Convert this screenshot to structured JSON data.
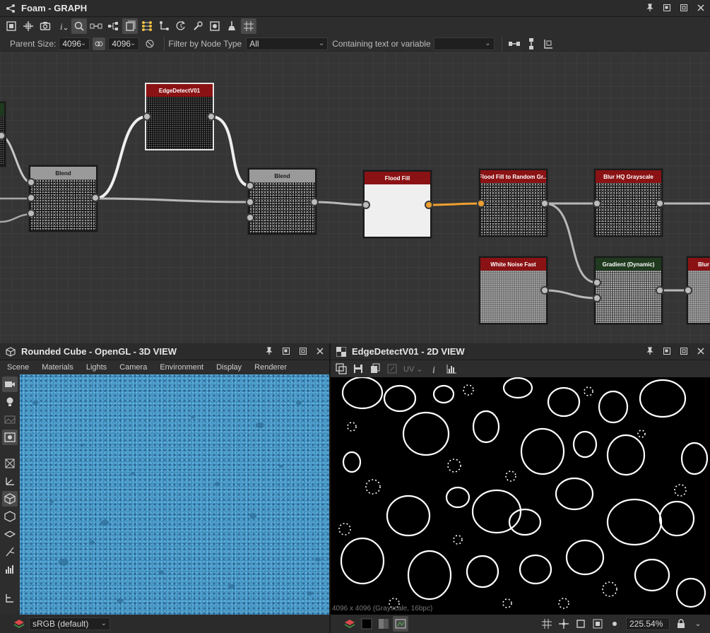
{
  "graph_panel": {
    "title": "Foam - GRAPH",
    "toolbar_icons": [
      "frame-all-icon",
      "fit-icon",
      "camera-icon",
      "info-icon",
      "zoom-icon",
      "link-icon",
      "hierarchy-icon",
      "layer-icon",
      "align-icon",
      "pin-node-icon",
      "loop-icon",
      "tools-icon",
      "display-icon",
      "clean-icon",
      "grid-icon"
    ],
    "filter": {
      "parent_size_label": "Parent Size:",
      "parent_size_w": "4096",
      "parent_size_h": "4096",
      "filter_label": "Filter by Node Type",
      "filter_value": "All",
      "containing_label": "Containing text or variable",
      "containing_value": ""
    },
    "nodes": {
      "blend1": "Blend",
      "edge": "EdgeDetectV01",
      "blend2": "Blend",
      "flood": "Flood Fill",
      "ffrandom": "Flood Fill to Random Gr...",
      "blurhq": "Blur HQ Grayscale",
      "whitenoise": "White Noise Fast",
      "gradient": "Gradient (Dynamic)",
      "blur2": "Blur"
    }
  },
  "view3d": {
    "title": "Rounded Cube - OpenGL - 3D VIEW",
    "menu": [
      "Scene",
      "Materials",
      "Lights",
      "Camera",
      "Environment",
      "Display",
      "Renderer"
    ],
    "colorspace": "sRGB (default)"
  },
  "view2d": {
    "title": "EdgeDetectV01 - 2D VIEW",
    "uv_label": "UV",
    "info": "4096 x 4096 (Grayscale, 16bpc)",
    "zoom": "225.54%"
  },
  "colors": {
    "accent_orange": "#f0a030",
    "node_red": "#8b1214",
    "viewport_blue": "#4a9ccc"
  }
}
